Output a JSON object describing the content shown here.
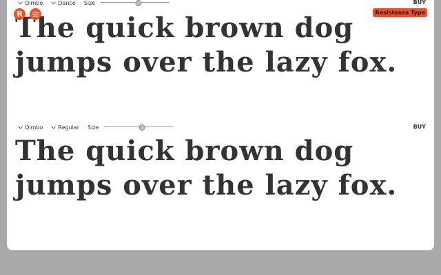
{
  "header": {
    "logo_letter": "R",
    "brand": "Resistenza Type"
  },
  "rows": [
    {
      "family": "Qimbo",
      "style": "Dance",
      "size_label": "Size",
      "size_value_fraction": 0.55,
      "buy_label": "BUY",
      "sample_text": "The quick brown dog jumps over the lazy fox."
    },
    {
      "family": "Qimbo",
      "style": "Regular",
      "size_label": "Size",
      "size_value_fraction": 0.55,
      "buy_label": "BUY",
      "sample_text": "The quick brown dog jumps over the lazy fox."
    }
  ],
  "colors": {
    "accent": "#f04e23",
    "page_background": "#a9a9a9",
    "card_background": "#ffffff",
    "text": "#333333"
  }
}
